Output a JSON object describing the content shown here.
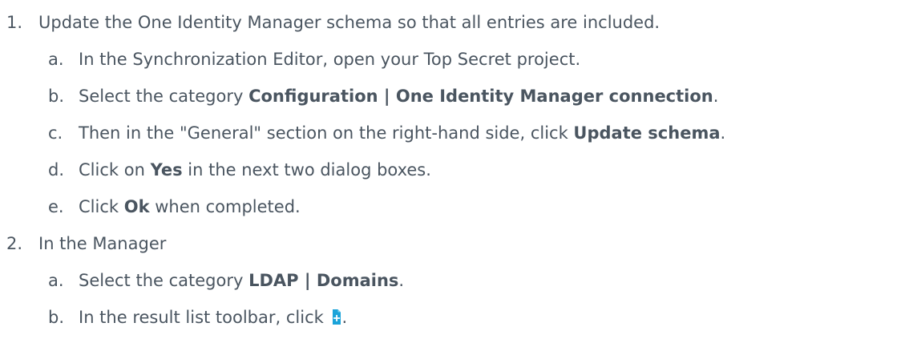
{
  "steps": [
    {
      "num": "1.",
      "text": "Update the One Identity Manager schema so that all entries are included.",
      "substeps": [
        {
          "letter": "a.",
          "text": "In the Synchronization Editor, open your Top Secret project."
        },
        {
          "letter": "b.",
          "pre": "Select the category ",
          "bold": "Configuration | One Identity Manager connection",
          "post": "."
        },
        {
          "letter": "c.",
          "pre": "Then in the \"General\" section on the right-hand side, click ",
          "bold": "Update schema",
          "post": "."
        },
        {
          "letter": "d.",
          "pre": "Click on ",
          "bold": "Yes",
          "post": " in the next two dialog boxes."
        },
        {
          "letter": "e.",
          "pre": "Click ",
          "bold": "Ok",
          "post": " when completed."
        }
      ]
    },
    {
      "num": "2.",
      "text": "In the Manager",
      "substeps": [
        {
          "letter": "a.",
          "pre": "Select the category ",
          "bold": "LDAP | Domains",
          "post": "."
        },
        {
          "letter": "b.",
          "pre": "In the result list toolbar, click ",
          "icon": "new-document-icon",
          "post": "."
        }
      ]
    }
  ],
  "colors": {
    "text": "#4a5560",
    "icon_main": "#1aa3d9",
    "icon_light": "#7fd0ee"
  }
}
